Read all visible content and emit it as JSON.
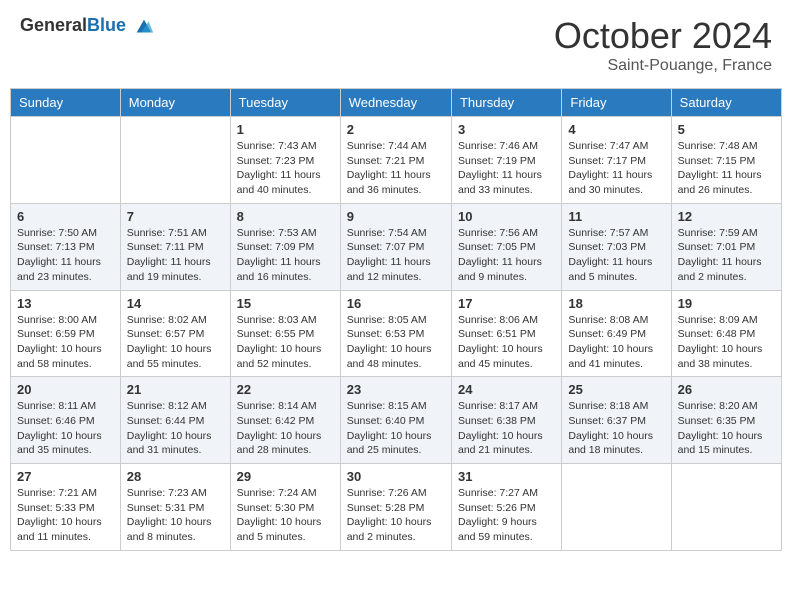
{
  "header": {
    "logo_general": "General",
    "logo_blue": "Blue",
    "month": "October 2024",
    "location": "Saint-Pouange, France"
  },
  "weekdays": [
    "Sunday",
    "Monday",
    "Tuesday",
    "Wednesday",
    "Thursday",
    "Friday",
    "Saturday"
  ],
  "weeks": [
    [
      {
        "day": "",
        "sunrise": "",
        "sunset": "",
        "daylight": ""
      },
      {
        "day": "",
        "sunrise": "",
        "sunset": "",
        "daylight": ""
      },
      {
        "day": "1",
        "sunrise": "Sunrise: 7:43 AM",
        "sunset": "Sunset: 7:23 PM",
        "daylight": "Daylight: 11 hours and 40 minutes."
      },
      {
        "day": "2",
        "sunrise": "Sunrise: 7:44 AM",
        "sunset": "Sunset: 7:21 PM",
        "daylight": "Daylight: 11 hours and 36 minutes."
      },
      {
        "day": "3",
        "sunrise": "Sunrise: 7:46 AM",
        "sunset": "Sunset: 7:19 PM",
        "daylight": "Daylight: 11 hours and 33 minutes."
      },
      {
        "day": "4",
        "sunrise": "Sunrise: 7:47 AM",
        "sunset": "Sunset: 7:17 PM",
        "daylight": "Daylight: 11 hours and 30 minutes."
      },
      {
        "day": "5",
        "sunrise": "Sunrise: 7:48 AM",
        "sunset": "Sunset: 7:15 PM",
        "daylight": "Daylight: 11 hours and 26 minutes."
      }
    ],
    [
      {
        "day": "6",
        "sunrise": "Sunrise: 7:50 AM",
        "sunset": "Sunset: 7:13 PM",
        "daylight": "Daylight: 11 hours and 23 minutes."
      },
      {
        "day": "7",
        "sunrise": "Sunrise: 7:51 AM",
        "sunset": "Sunset: 7:11 PM",
        "daylight": "Daylight: 11 hours and 19 minutes."
      },
      {
        "day": "8",
        "sunrise": "Sunrise: 7:53 AM",
        "sunset": "Sunset: 7:09 PM",
        "daylight": "Daylight: 11 hours and 16 minutes."
      },
      {
        "day": "9",
        "sunrise": "Sunrise: 7:54 AM",
        "sunset": "Sunset: 7:07 PM",
        "daylight": "Daylight: 11 hours and 12 minutes."
      },
      {
        "day": "10",
        "sunrise": "Sunrise: 7:56 AM",
        "sunset": "Sunset: 7:05 PM",
        "daylight": "Daylight: 11 hours and 9 minutes."
      },
      {
        "day": "11",
        "sunrise": "Sunrise: 7:57 AM",
        "sunset": "Sunset: 7:03 PM",
        "daylight": "Daylight: 11 hours and 5 minutes."
      },
      {
        "day": "12",
        "sunrise": "Sunrise: 7:59 AM",
        "sunset": "Sunset: 7:01 PM",
        "daylight": "Daylight: 11 hours and 2 minutes."
      }
    ],
    [
      {
        "day": "13",
        "sunrise": "Sunrise: 8:00 AM",
        "sunset": "Sunset: 6:59 PM",
        "daylight": "Daylight: 10 hours and 58 minutes."
      },
      {
        "day": "14",
        "sunrise": "Sunrise: 8:02 AM",
        "sunset": "Sunset: 6:57 PM",
        "daylight": "Daylight: 10 hours and 55 minutes."
      },
      {
        "day": "15",
        "sunrise": "Sunrise: 8:03 AM",
        "sunset": "Sunset: 6:55 PM",
        "daylight": "Daylight: 10 hours and 52 minutes."
      },
      {
        "day": "16",
        "sunrise": "Sunrise: 8:05 AM",
        "sunset": "Sunset: 6:53 PM",
        "daylight": "Daylight: 10 hours and 48 minutes."
      },
      {
        "day": "17",
        "sunrise": "Sunrise: 8:06 AM",
        "sunset": "Sunset: 6:51 PM",
        "daylight": "Daylight: 10 hours and 45 minutes."
      },
      {
        "day": "18",
        "sunrise": "Sunrise: 8:08 AM",
        "sunset": "Sunset: 6:49 PM",
        "daylight": "Daylight: 10 hours and 41 minutes."
      },
      {
        "day": "19",
        "sunrise": "Sunrise: 8:09 AM",
        "sunset": "Sunset: 6:48 PM",
        "daylight": "Daylight: 10 hours and 38 minutes."
      }
    ],
    [
      {
        "day": "20",
        "sunrise": "Sunrise: 8:11 AM",
        "sunset": "Sunset: 6:46 PM",
        "daylight": "Daylight: 10 hours and 35 minutes."
      },
      {
        "day": "21",
        "sunrise": "Sunrise: 8:12 AM",
        "sunset": "Sunset: 6:44 PM",
        "daylight": "Daylight: 10 hours and 31 minutes."
      },
      {
        "day": "22",
        "sunrise": "Sunrise: 8:14 AM",
        "sunset": "Sunset: 6:42 PM",
        "daylight": "Daylight: 10 hours and 28 minutes."
      },
      {
        "day": "23",
        "sunrise": "Sunrise: 8:15 AM",
        "sunset": "Sunset: 6:40 PM",
        "daylight": "Daylight: 10 hours and 25 minutes."
      },
      {
        "day": "24",
        "sunrise": "Sunrise: 8:17 AM",
        "sunset": "Sunset: 6:38 PM",
        "daylight": "Daylight: 10 hours and 21 minutes."
      },
      {
        "day": "25",
        "sunrise": "Sunrise: 8:18 AM",
        "sunset": "Sunset: 6:37 PM",
        "daylight": "Daylight: 10 hours and 18 minutes."
      },
      {
        "day": "26",
        "sunrise": "Sunrise: 8:20 AM",
        "sunset": "Sunset: 6:35 PM",
        "daylight": "Daylight: 10 hours and 15 minutes."
      }
    ],
    [
      {
        "day": "27",
        "sunrise": "Sunrise: 7:21 AM",
        "sunset": "Sunset: 5:33 PM",
        "daylight": "Daylight: 10 hours and 11 minutes."
      },
      {
        "day": "28",
        "sunrise": "Sunrise: 7:23 AM",
        "sunset": "Sunset: 5:31 PM",
        "daylight": "Daylight: 10 hours and 8 minutes."
      },
      {
        "day": "29",
        "sunrise": "Sunrise: 7:24 AM",
        "sunset": "Sunset: 5:30 PM",
        "daylight": "Daylight: 10 hours and 5 minutes."
      },
      {
        "day": "30",
        "sunrise": "Sunrise: 7:26 AM",
        "sunset": "Sunset: 5:28 PM",
        "daylight": "Daylight: 10 hours and 2 minutes."
      },
      {
        "day": "31",
        "sunrise": "Sunrise: 7:27 AM",
        "sunset": "Sunset: 5:26 PM",
        "daylight": "Daylight: 9 hours and 59 minutes."
      },
      {
        "day": "",
        "sunrise": "",
        "sunset": "",
        "daylight": ""
      },
      {
        "day": "",
        "sunrise": "",
        "sunset": "",
        "daylight": ""
      }
    ]
  ]
}
